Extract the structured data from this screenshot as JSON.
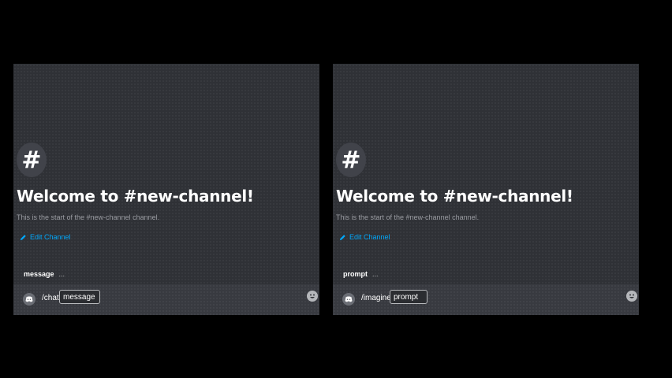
{
  "colors": {
    "page_background": "#000000",
    "panel_background": "#2f3136",
    "link": "#00a8fc",
    "heading": "#ffffff",
    "muted_text": "#9a9ca2"
  },
  "panels": [
    {
      "hash_symbol": "#",
      "welcome_title": "Welcome to #new-channel!",
      "subtitle": "This is the start of the #new-channel channel.",
      "edit_channel_label": "Edit Channel",
      "option": {
        "name": "message",
        "description": "..."
      },
      "input": {
        "command": "/chat",
        "param_label": "message"
      },
      "icons": {
        "avatar": "discord-icon",
        "emoji": "emoji-smile-icon",
        "edit": "pencil-icon"
      }
    },
    {
      "hash_symbol": "#",
      "welcome_title": "Welcome to #new-channel!",
      "subtitle": "This is the start of the #new-channel channel.",
      "edit_channel_label": "Edit Channel",
      "option": {
        "name": "prompt",
        "description": "..."
      },
      "input": {
        "command": "/imagine",
        "param_label": "prompt"
      },
      "icons": {
        "avatar": "discord-icon",
        "emoji": "emoji-smile-icon",
        "edit": "pencil-icon"
      }
    }
  ]
}
